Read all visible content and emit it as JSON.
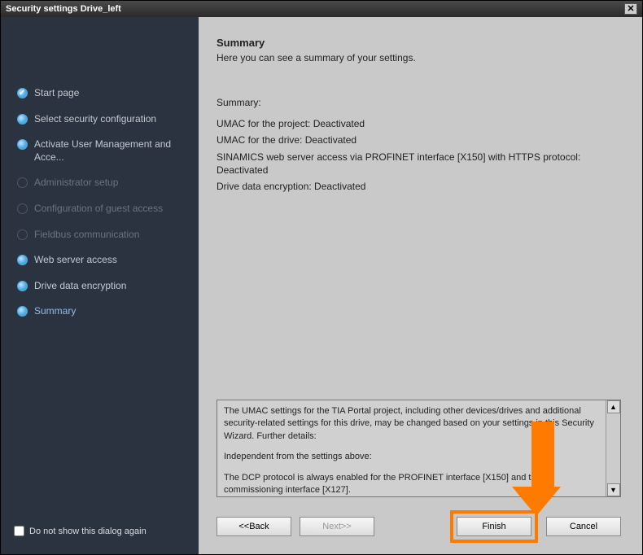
{
  "window": {
    "title": "Security settings Drive_left"
  },
  "sidebar": {
    "items": [
      {
        "label": "Start page",
        "state": "check"
      },
      {
        "label": "Select security configuration",
        "state": "on"
      },
      {
        "label": "Activate User Management and Acce...",
        "state": "on"
      },
      {
        "label": "Administrator setup",
        "state": "dim"
      },
      {
        "label": "Configuration of guest access",
        "state": "dim"
      },
      {
        "label": "Fieldbus communication",
        "state": "dim"
      },
      {
        "label": "Web server access",
        "state": "on"
      },
      {
        "label": "Drive data encryption",
        "state": "on"
      },
      {
        "label": "Summary",
        "state": "on",
        "active": true
      }
    ],
    "dontshow_label": "Do not show this dialog again"
  },
  "main": {
    "title": "Summary",
    "subtitle": "Here you can see a summary of your settings.",
    "summary_header": "Summary:",
    "lines": {
      "l1": "UMAC for the project: Deactivated",
      "l2": "UMAC for the drive: Deactivated",
      "l3": "SINAMICS web server access via PROFINET interface [X150] with HTTPS protocol: Deactivated",
      "l4": "Drive data encryption: Deactivated"
    },
    "details": {
      "p1": "The UMAC settings for the TIA Portal project, including other devices/drives and additional security-related settings for this drive, may be changed based on your settings in this Security Wizard. Further details:",
      "p2": "Independent from the settings above:",
      "p3": "The DCP protocol is always enabled for the PROFINET interface [X150] and the commissioning interface [X127]."
    }
  },
  "buttons": {
    "back": "<<Back",
    "next": "Next>>",
    "finish": "Finish",
    "cancel": "Cancel"
  }
}
